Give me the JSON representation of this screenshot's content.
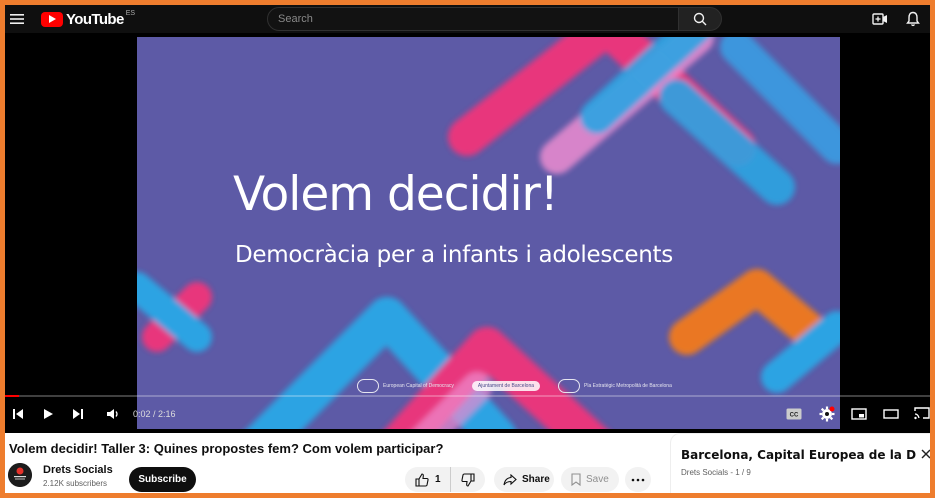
{
  "header": {
    "logo_text": "YouTube",
    "country_code": "ES",
    "search_placeholder": "Search"
  },
  "video": {
    "title_text": "Volem decidir!",
    "subtitle_text": "Democràcia per a infants i adolescents",
    "logos": [
      {
        "label": "European Capital of Democracy"
      },
      {
        "label": "Ajuntament de Barcelona"
      },
      {
        "label": "Pla Estratègic Metropolità de Barcelona"
      }
    ],
    "bg_color": "#5d5aa6"
  },
  "player": {
    "time": "0:02 / 2:16",
    "progress_fraction": 0.015,
    "accent_color": "#ff0000"
  },
  "details": {
    "heading": "Volem decidir! Taller 3: Quines propostes fem? Com volem participar?",
    "channel_name": "Drets Socials",
    "subscribers": "2.12K subscribers",
    "subscribe_label": "Subscribe",
    "likes": "1",
    "share_label": "Share",
    "save_label": "Save"
  },
  "playlist": {
    "title": "Barcelona, Capital Europea de la Democ",
    "meta": "Drets Socials - 1 / 9"
  }
}
